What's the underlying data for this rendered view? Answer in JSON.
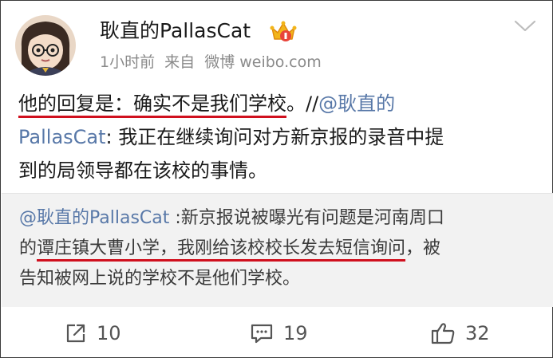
{
  "post": {
    "author": "耿直的PallasCat",
    "time": "1小时前",
    "source_prefix": "来自",
    "source": "微博 weibo.com",
    "line1_reply_highlight": "他的回复是：确实不是我们学校",
    "line1_rest": "。//",
    "line1_mention": "@耿直的",
    "line2_mention": "PallasCat",
    "line2_text": ": 我正在继续询问对方新京报的录音中提",
    "line3_text": "到的局领导都在该校的事情。"
  },
  "quote": {
    "mention": "@耿直的PallasCat",
    "line1_text": " :新京报说被曝光有问题是河南周口",
    "line2_prefix": "的",
    "line2_highlight": "谭庄镇大曹小学，我刚给该校校长发去短信询问",
    "line2_suffix": "，被",
    "line3_text": "告知被网上说的学校不是他们学校。"
  },
  "actions": {
    "repost_count": "10",
    "comment_count": "19",
    "like_count": "32"
  },
  "icons": {
    "avatar": "cartoon-avatar-icon",
    "vip": "vip-crown-badge-icon",
    "menu": "chevron-down-icon",
    "repost": "repost-icon",
    "comment": "comment-icon",
    "like": "thumbs-up-icon"
  },
  "colors": {
    "mention": "#5878a8",
    "highlight_underline": "#d0101e",
    "quote_background": "#f2f2f2",
    "meta_text": "#8a8a8a"
  }
}
